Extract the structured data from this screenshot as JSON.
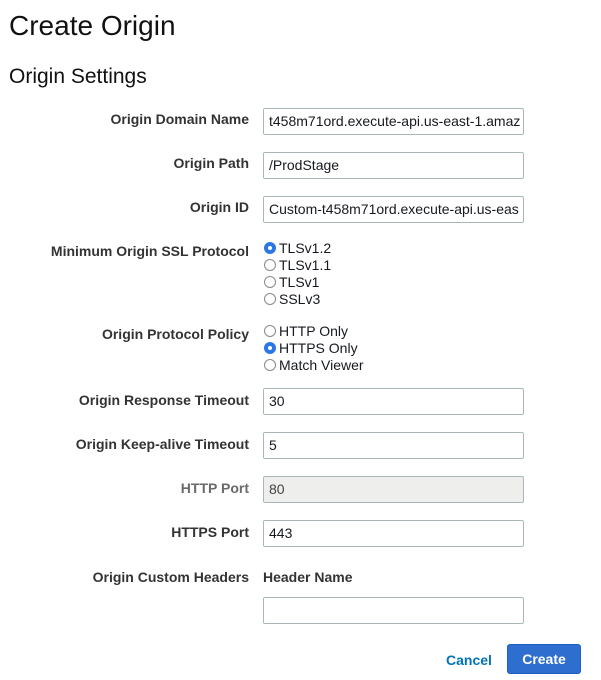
{
  "page": {
    "title": "Create Origin",
    "section_title": "Origin Settings"
  },
  "form": {
    "origin_domain_name": {
      "label": "Origin Domain Name",
      "value": "t458m71ord.execute-api.us-east-1.amaz"
    },
    "origin_path": {
      "label": "Origin Path",
      "value": "/ProdStage"
    },
    "origin_id": {
      "label": "Origin ID",
      "value": "Custom-t458m71ord.execute-api.us-eas"
    },
    "ssl_protocol": {
      "label": "Minimum Origin SSL Protocol",
      "options": [
        {
          "label": "TLSv1.2",
          "checked": true
        },
        {
          "label": "TLSv1.1",
          "checked": false
        },
        {
          "label": "TLSv1",
          "checked": false
        },
        {
          "label": "SSLv3",
          "checked": false
        }
      ]
    },
    "protocol_policy": {
      "label": "Origin Protocol Policy",
      "options": [
        {
          "label": "HTTP Only",
          "checked": false
        },
        {
          "label": "HTTPS Only",
          "checked": true
        },
        {
          "label": "Match Viewer",
          "checked": false
        }
      ]
    },
    "response_timeout": {
      "label": "Origin Response Timeout",
      "value": "30"
    },
    "keepalive_timeout": {
      "label": "Origin Keep-alive Timeout",
      "value": "5"
    },
    "http_port": {
      "label": "HTTP Port",
      "value": "80"
    },
    "https_port": {
      "label": "HTTPS Port",
      "value": "443"
    },
    "custom_headers": {
      "label": "Origin Custom Headers",
      "column_header": "Header Name",
      "value": ""
    }
  },
  "actions": {
    "cancel_label": "Cancel",
    "create_label": "Create"
  }
}
